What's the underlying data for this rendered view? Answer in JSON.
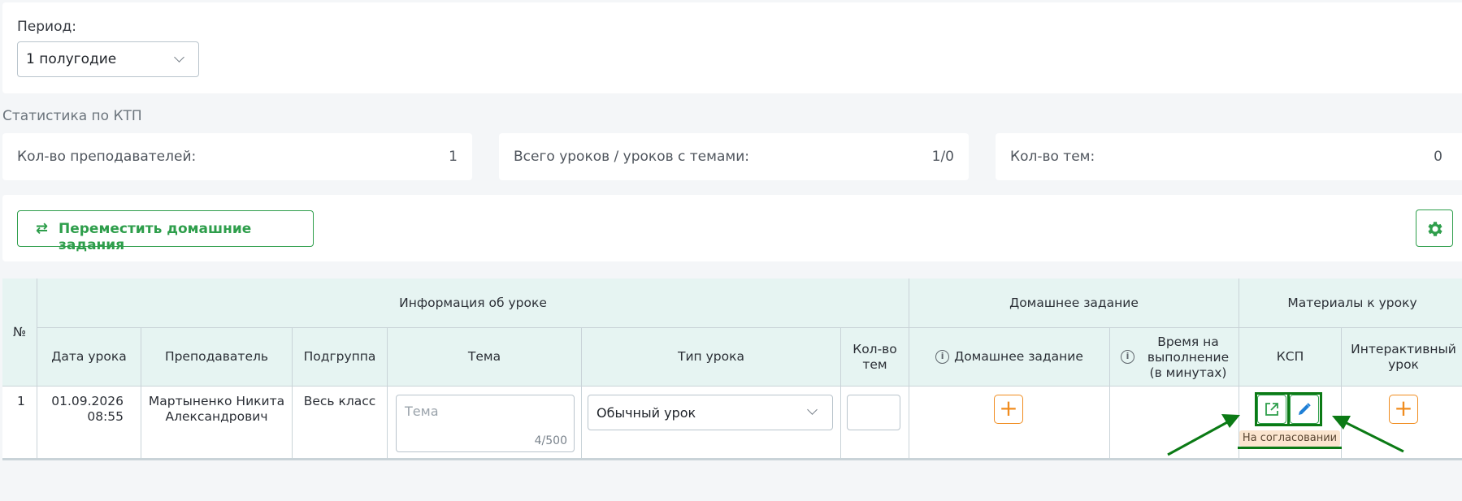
{
  "period": {
    "label": "Период:",
    "selected": "1 полугодие"
  },
  "stats": {
    "title": "Статистика по КТП",
    "items": [
      {
        "label": "Кол-во преподавателей:",
        "value": "1"
      },
      {
        "label": "Всего уроков / уроков с темами:",
        "value": "1/0"
      },
      {
        "label": "Кол-во тем:",
        "value": "0"
      }
    ]
  },
  "toolbar": {
    "move_homework_label": "Переместить домашние задания"
  },
  "table": {
    "group_headers": [
      "Информация об уроке",
      "Домашнее задание",
      "Материалы к уроку"
    ],
    "num_header": "№",
    "columns": {
      "date": "Дата урока",
      "teacher": "Преподаватель",
      "subgroup": "Подгруппа",
      "topic": "Тема",
      "lesson_type": "Тип урока",
      "topic_count": "Кол-во тем",
      "homework": "Домашнее задание",
      "time": "Время на выполнение (в минутах)",
      "ksp": "КСП",
      "interactive": "Интерактивный урок"
    },
    "row": {
      "num": "1",
      "date": "01.09.2026",
      "time": "08:55",
      "teacher": "Мартыненко Никита Александрович",
      "subgroup": "Весь класс",
      "topic_placeholder": "Тема",
      "topic_counter": "4/500",
      "lesson_type": "Обычный урок",
      "ksp_status": "На согласовании"
    }
  },
  "colors": {
    "green": "#2e9e4b",
    "orange": "#f08c1e",
    "header_bg": "#e6f4f2",
    "annotation": "#0b7a15"
  }
}
